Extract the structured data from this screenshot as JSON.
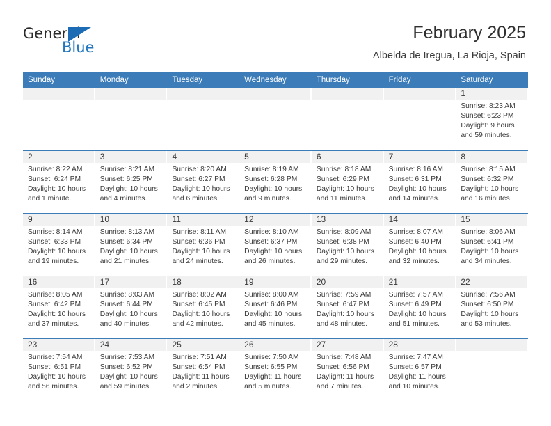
{
  "brand": {
    "name_top": "General",
    "name_bottom": "Blue",
    "triangle_color": "#1b6cb5",
    "blue_color": "#2176bd"
  },
  "header": {
    "title": "February 2025",
    "subtitle": "Albelda de Iregua, La Rioja, Spain"
  },
  "theme": {
    "header_blue": "#3b7cb9",
    "day_band_gray": "#f1f1f1",
    "text": "#3a3a3a"
  },
  "weekdays": [
    "Sunday",
    "Monday",
    "Tuesday",
    "Wednesday",
    "Thursday",
    "Friday",
    "Saturday"
  ],
  "weeks": [
    [
      {
        "day": "",
        "lines": []
      },
      {
        "day": "",
        "lines": []
      },
      {
        "day": "",
        "lines": []
      },
      {
        "day": "",
        "lines": []
      },
      {
        "day": "",
        "lines": []
      },
      {
        "day": "",
        "lines": []
      },
      {
        "day": "1",
        "lines": [
          "Sunrise: 8:23 AM",
          "Sunset: 6:23 PM",
          "Daylight: 9 hours",
          "and 59 minutes."
        ]
      }
    ],
    [
      {
        "day": "2",
        "lines": [
          "Sunrise: 8:22 AM",
          "Sunset: 6:24 PM",
          "Daylight: 10 hours",
          "and 1 minute."
        ]
      },
      {
        "day": "3",
        "lines": [
          "Sunrise: 8:21 AM",
          "Sunset: 6:25 PM",
          "Daylight: 10 hours",
          "and 4 minutes."
        ]
      },
      {
        "day": "4",
        "lines": [
          "Sunrise: 8:20 AM",
          "Sunset: 6:27 PM",
          "Daylight: 10 hours",
          "and 6 minutes."
        ]
      },
      {
        "day": "5",
        "lines": [
          "Sunrise: 8:19 AM",
          "Sunset: 6:28 PM",
          "Daylight: 10 hours",
          "and 9 minutes."
        ]
      },
      {
        "day": "6",
        "lines": [
          "Sunrise: 8:18 AM",
          "Sunset: 6:29 PM",
          "Daylight: 10 hours",
          "and 11 minutes."
        ]
      },
      {
        "day": "7",
        "lines": [
          "Sunrise: 8:16 AM",
          "Sunset: 6:31 PM",
          "Daylight: 10 hours",
          "and 14 minutes."
        ]
      },
      {
        "day": "8",
        "lines": [
          "Sunrise: 8:15 AM",
          "Sunset: 6:32 PM",
          "Daylight: 10 hours",
          "and 16 minutes."
        ]
      }
    ],
    [
      {
        "day": "9",
        "lines": [
          "Sunrise: 8:14 AM",
          "Sunset: 6:33 PM",
          "Daylight: 10 hours",
          "and 19 minutes."
        ]
      },
      {
        "day": "10",
        "lines": [
          "Sunrise: 8:13 AM",
          "Sunset: 6:34 PM",
          "Daylight: 10 hours",
          "and 21 minutes."
        ]
      },
      {
        "day": "11",
        "lines": [
          "Sunrise: 8:11 AM",
          "Sunset: 6:36 PM",
          "Daylight: 10 hours",
          "and 24 minutes."
        ]
      },
      {
        "day": "12",
        "lines": [
          "Sunrise: 8:10 AM",
          "Sunset: 6:37 PM",
          "Daylight: 10 hours",
          "and 26 minutes."
        ]
      },
      {
        "day": "13",
        "lines": [
          "Sunrise: 8:09 AM",
          "Sunset: 6:38 PM",
          "Daylight: 10 hours",
          "and 29 minutes."
        ]
      },
      {
        "day": "14",
        "lines": [
          "Sunrise: 8:07 AM",
          "Sunset: 6:40 PM",
          "Daylight: 10 hours",
          "and 32 minutes."
        ]
      },
      {
        "day": "15",
        "lines": [
          "Sunrise: 8:06 AM",
          "Sunset: 6:41 PM",
          "Daylight: 10 hours",
          "and 34 minutes."
        ]
      }
    ],
    [
      {
        "day": "16",
        "lines": [
          "Sunrise: 8:05 AM",
          "Sunset: 6:42 PM",
          "Daylight: 10 hours",
          "and 37 minutes."
        ]
      },
      {
        "day": "17",
        "lines": [
          "Sunrise: 8:03 AM",
          "Sunset: 6:44 PM",
          "Daylight: 10 hours",
          "and 40 minutes."
        ]
      },
      {
        "day": "18",
        "lines": [
          "Sunrise: 8:02 AM",
          "Sunset: 6:45 PM",
          "Daylight: 10 hours",
          "and 42 minutes."
        ]
      },
      {
        "day": "19",
        "lines": [
          "Sunrise: 8:00 AM",
          "Sunset: 6:46 PM",
          "Daylight: 10 hours",
          "and 45 minutes."
        ]
      },
      {
        "day": "20",
        "lines": [
          "Sunrise: 7:59 AM",
          "Sunset: 6:47 PM",
          "Daylight: 10 hours",
          "and 48 minutes."
        ]
      },
      {
        "day": "21",
        "lines": [
          "Sunrise: 7:57 AM",
          "Sunset: 6:49 PM",
          "Daylight: 10 hours",
          "and 51 minutes."
        ]
      },
      {
        "day": "22",
        "lines": [
          "Sunrise: 7:56 AM",
          "Sunset: 6:50 PM",
          "Daylight: 10 hours",
          "and 53 minutes."
        ]
      }
    ],
    [
      {
        "day": "23",
        "lines": [
          "Sunrise: 7:54 AM",
          "Sunset: 6:51 PM",
          "Daylight: 10 hours",
          "and 56 minutes."
        ]
      },
      {
        "day": "24",
        "lines": [
          "Sunrise: 7:53 AM",
          "Sunset: 6:52 PM",
          "Daylight: 10 hours",
          "and 59 minutes."
        ]
      },
      {
        "day": "25",
        "lines": [
          "Sunrise: 7:51 AM",
          "Sunset: 6:54 PM",
          "Daylight: 11 hours",
          "and 2 minutes."
        ]
      },
      {
        "day": "26",
        "lines": [
          "Sunrise: 7:50 AM",
          "Sunset: 6:55 PM",
          "Daylight: 11 hours",
          "and 5 minutes."
        ]
      },
      {
        "day": "27",
        "lines": [
          "Sunrise: 7:48 AM",
          "Sunset: 6:56 PM",
          "Daylight: 11 hours",
          "and 7 minutes."
        ]
      },
      {
        "day": "28",
        "lines": [
          "Sunrise: 7:47 AM",
          "Sunset: 6:57 PM",
          "Daylight: 11 hours",
          "and 10 minutes."
        ]
      },
      {
        "day": "",
        "lines": []
      }
    ]
  ]
}
